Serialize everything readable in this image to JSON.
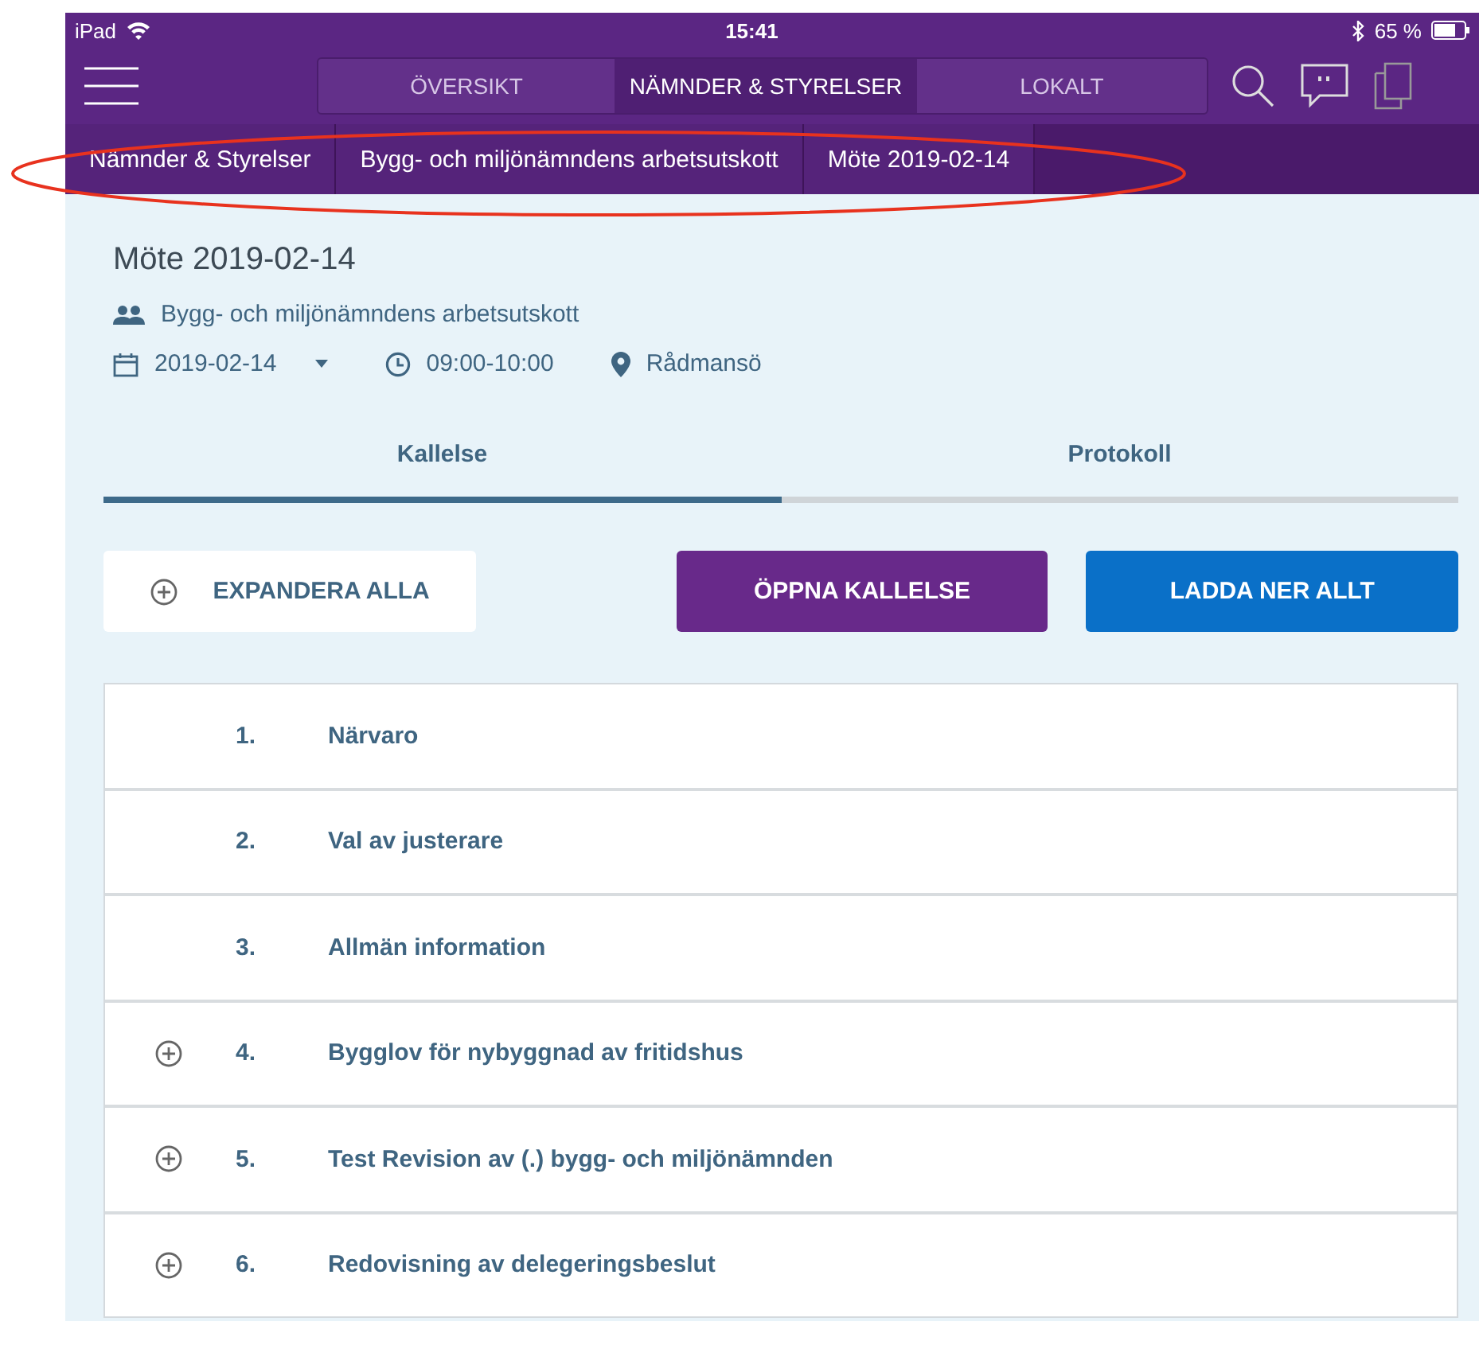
{
  "status_bar": {
    "device": "iPad",
    "time": "15:41",
    "battery": "65 %"
  },
  "nav_tabs": [
    {
      "label": "ÖVERSIKT",
      "selected": false
    },
    {
      "label": "NÄMNDER & STYRELSER",
      "selected": true
    },
    {
      "label": "LOKALT",
      "selected": false
    }
  ],
  "breadcrumbs": [
    "Nämnder & Styrelser",
    "Bygg- och miljönämndens arbetsutskott",
    "Möte 2019-02-14"
  ],
  "meeting": {
    "title": "Möte 2019-02-14",
    "committee": "Bygg- och miljönämndens arbetsutskott",
    "date": "2019-02-14",
    "time": "09:00-10:00",
    "place": "Rådmansö"
  },
  "tabs": [
    {
      "label": "Kallelse",
      "selected": true
    },
    {
      "label": "Protokoll",
      "selected": false
    }
  ],
  "buttons": [
    {
      "kind": "expand",
      "label": "EXPANDERA ALLA"
    },
    {
      "kind": "primary",
      "label": "ÖPPNA KALLELSE"
    },
    {
      "kind": "download",
      "label": "LADDA NER ALLT"
    }
  ],
  "agenda": [
    {
      "number": "1.",
      "title": "Närvaro",
      "expandable": false
    },
    {
      "number": "2.",
      "title": "Val av justerare",
      "expandable": false
    },
    {
      "number": "3.",
      "title": "Allmän information",
      "expandable": false
    },
    {
      "number": "4.",
      "title": "Bygglov för nybyggnad av fritidshus",
      "expandable": true
    },
    {
      "number": "5.",
      "title": "Test Revision av (.) bygg- och miljönämnden",
      "expandable": true
    },
    {
      "number": "6.",
      "title": "Redovisning av delegeringsbeslut",
      "expandable": true
    }
  ]
}
